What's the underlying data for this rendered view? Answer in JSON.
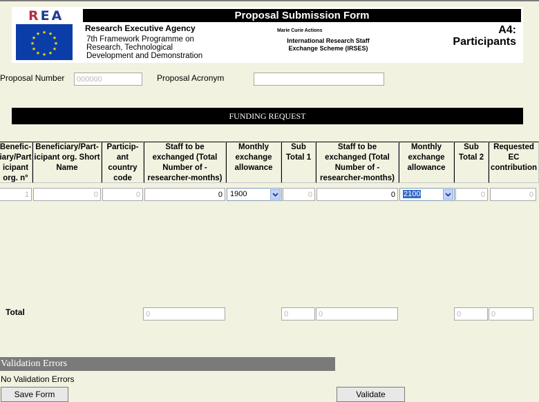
{
  "header": {
    "logo_text_r": "R",
    "logo_text_rest": "EA",
    "form_title": "Proposal Submission Form",
    "agency": "Research Executive Agency",
    "programme_line1": "7th Framework Programme on",
    "programme_line2": "Research, Technological",
    "programme_line3": "Development and Demonstration",
    "action_small": "Marie Curie Actions",
    "scheme_line1": "International Research Staff",
    "scheme_line2": "Exchange Scheme (IRSES)",
    "section_code": "A4:",
    "section_name": "Participants"
  },
  "proposal": {
    "number_label": "Proposal Number",
    "number_value": "000000",
    "acronym_label": "Proposal Acronym",
    "acronym_value": ""
  },
  "funding": {
    "title": "FUNDING REQUEST",
    "columns": [
      "Benefic- iary/Part icipant org. n°",
      "Beneficiary/Part- icipant org. Short Name",
      "Particip- ant country code",
      "Staff to be exchanged (Total Number of - researcher-months)",
      "Monthly exchange allowance",
      "Sub Total 1",
      "Staff to be exchanged (Total Number of - researcher-months)",
      "Monthly exchange allowance",
      "Sub Total 2",
      "Requested EC contribution"
    ],
    "row": {
      "org_no": "1",
      "short_name": "0",
      "country_code": "0",
      "staff_months_1": "0",
      "allowance_1": "1900",
      "sub_total_1": "0",
      "staff_months_2": "0",
      "allowance_2": "2100",
      "sub_total_2": "0",
      "ec_contribution": "0"
    }
  },
  "totals": {
    "label": "Total",
    "staff_months_1": "0",
    "sub_total_1": "0",
    "staff_months_2": "0",
    "sub_total_2": "0",
    "ec_contribution": "0"
  },
  "validation": {
    "title": "Validation Errors",
    "message": "No Validation Errors"
  },
  "buttons": {
    "save": "Save Form",
    "validate": "Validate"
  },
  "colors": {
    "background": "#f2f2e0",
    "header_bar": "#000000",
    "validation_bar": "#7a7a7a",
    "select_highlight": "#316ac5",
    "eu_blue": "#0a3da8",
    "rea_red": "#b22d43"
  }
}
